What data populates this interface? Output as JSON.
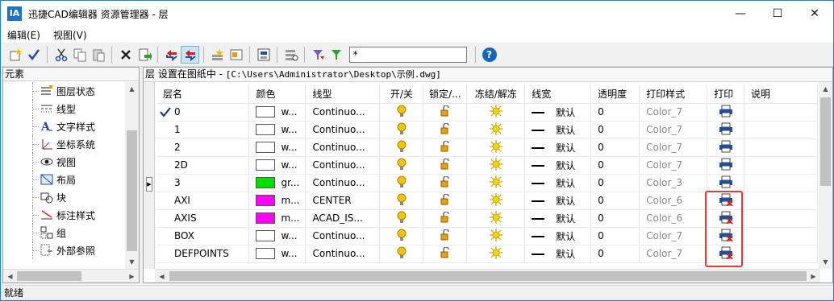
{
  "window": {
    "title": "迅捷CAD编辑器 资源管理器 - 层",
    "app_icon": "IA",
    "controls": {
      "minimize": "—",
      "maximize": "☐",
      "close": "✕"
    }
  },
  "menu": {
    "edit": "编辑(E)",
    "view": "视图(V)"
  },
  "toolbar": {
    "filter_value": "*",
    "help_label": "?"
  },
  "left_panel": {
    "header": "元素",
    "items": [
      {
        "label": "图层状态",
        "icon": "layer-state-icon"
      },
      {
        "label": "线型",
        "icon": "linetype-icon"
      },
      {
        "label": "文字样式",
        "icon": "text-style-icon"
      },
      {
        "label": "坐标系统",
        "icon": "ucs-icon"
      },
      {
        "label": "视图",
        "icon": "view-eye-icon"
      },
      {
        "label": "布局",
        "icon": "layout-icon"
      },
      {
        "label": "块",
        "icon": "block-icon"
      },
      {
        "label": "标注样式",
        "icon": "dimension-style-icon"
      },
      {
        "label": "组",
        "icon": "group-icon"
      },
      {
        "label": "外部参照",
        "icon": "xref-icon"
      }
    ]
  },
  "layers_panel": {
    "path_prefix": "层 设置在图纸中 - ",
    "path": "[C:\\Users\\Administrator\\Desktop\\示例.dwg]",
    "columns": [
      "层名",
      "颜色",
      "线型",
      "开/关",
      "锁定/...",
      "冻结/解冻",
      "线宽",
      "透明度",
      "打印样式",
      "打印",
      "说明"
    ],
    "rows": [
      {
        "current": true,
        "name": "0",
        "color": "#ffffff",
        "color_label": "w...",
        "linetype": "Continuo...",
        "lineweight": "默认",
        "transparency": "0",
        "plot_style": "Color_7",
        "plot": "printer-icon"
      },
      {
        "current": false,
        "name": "1",
        "color": "#ffffff",
        "color_label": "w...",
        "linetype": "Continuo...",
        "lineweight": "默认",
        "transparency": "0",
        "plot_style": "Color_7",
        "plot": "printer-icon"
      },
      {
        "current": false,
        "name": "2",
        "color": "#ffffff",
        "color_label": "w...",
        "linetype": "Continuo...",
        "lineweight": "默认",
        "transparency": "0",
        "plot_style": "Color_7",
        "plot": "printer-icon"
      },
      {
        "current": false,
        "name": "2D",
        "color": "#ffffff",
        "color_label": "w...",
        "linetype": "Continuo...",
        "lineweight": "默认",
        "transparency": "0",
        "plot_style": "Color_7",
        "plot": "printer-icon"
      },
      {
        "current": false,
        "name": "3",
        "color": "#00e000",
        "color_label": "gr...",
        "linetype": "Continuo...",
        "lineweight": "默认",
        "transparency": "0",
        "plot_style": "Color_3",
        "plot": "printer-icon"
      },
      {
        "current": false,
        "name": "AXI",
        "color": "#ff00ff",
        "color_label": "m...",
        "linetype": "CENTER",
        "lineweight": "默认",
        "transparency": "0",
        "plot_style": "Color_6",
        "plot": "no-plot-icon"
      },
      {
        "current": false,
        "name": "AXIS",
        "color": "#ff00ff",
        "color_label": "m...",
        "linetype": "ACAD_IS...",
        "lineweight": "默认",
        "transparency": "0",
        "plot_style": "Color_6",
        "plot": "no-plot-icon"
      },
      {
        "current": false,
        "name": "BOX",
        "color": "#ffffff",
        "color_label": "w...",
        "linetype": "Continuo...",
        "lineweight": "默认",
        "transparency": "0",
        "plot_style": "Color_7",
        "plot": "no-plot-icon"
      },
      {
        "current": false,
        "name": "DEFPOINTS",
        "color": "#ffffff",
        "color_label": "w...",
        "linetype": "Continuo...",
        "lineweight": "默认",
        "transparency": "0",
        "plot_style": "Color_7",
        "plot": "no-plot-icon"
      }
    ]
  },
  "status": "就绪",
  "colors": {
    "highlight": "#e53935",
    "bulb": "#f5c400",
    "lock": "#e6a300",
    "sun": "#f7d600"
  }
}
